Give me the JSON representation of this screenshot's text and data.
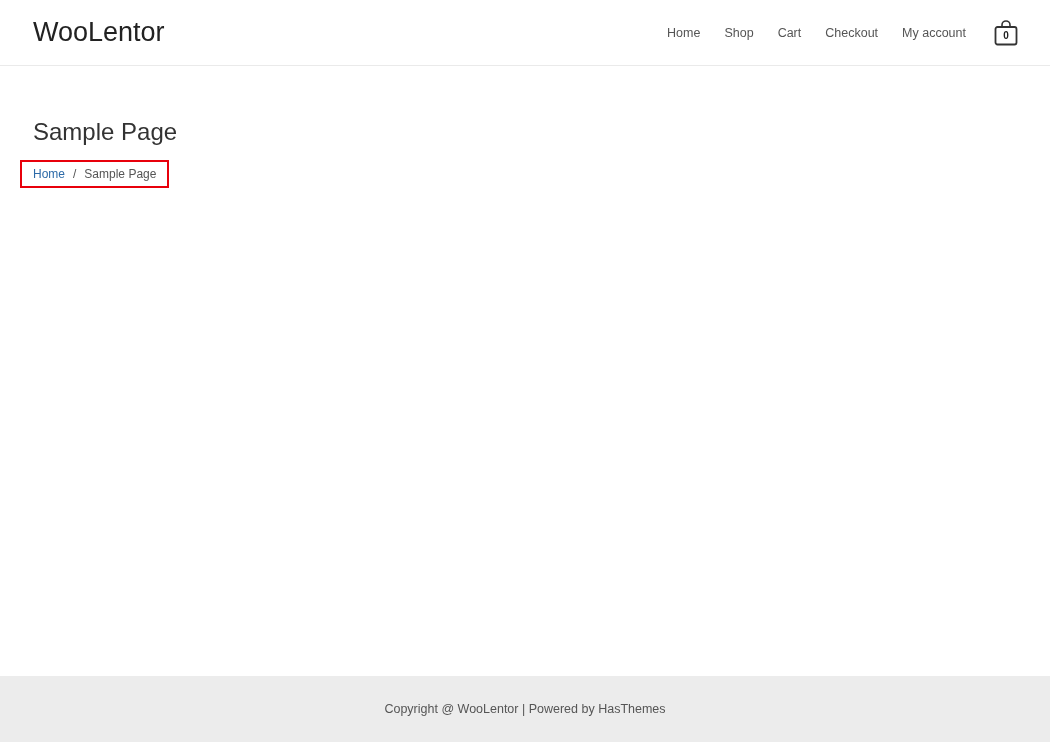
{
  "site_title": "WooLentor",
  "nav": [
    {
      "label": "Home"
    },
    {
      "label": "Shop"
    },
    {
      "label": "Cart"
    },
    {
      "label": "Checkout"
    },
    {
      "label": "My account"
    }
  ],
  "cart": {
    "count": "0"
  },
  "page_title": "Sample Page",
  "breadcrumb": {
    "highlighted": true,
    "items": [
      {
        "label": "Home",
        "kind": "link"
      },
      {
        "label": "/",
        "kind": "separator"
      },
      {
        "label": "Sample Page",
        "kind": "current"
      }
    ]
  },
  "footer": {
    "text": "Copyright @ WooLentor | Powered by HasThemes"
  }
}
